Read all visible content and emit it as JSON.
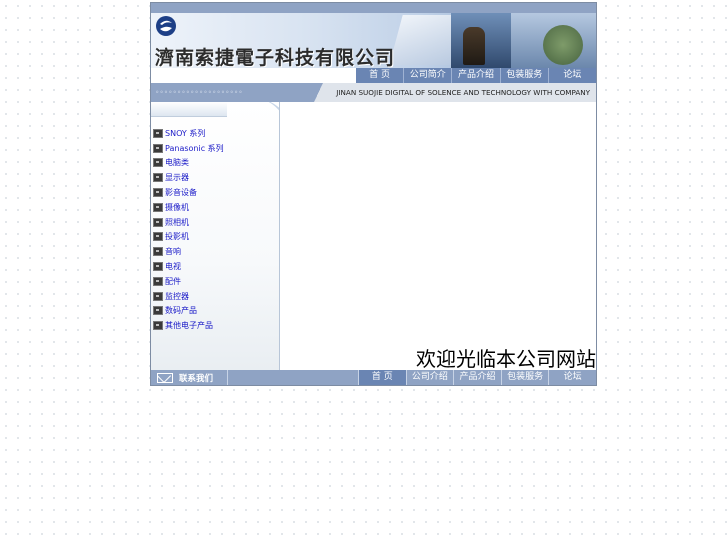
{
  "header": {
    "company_name": "濟南索捷電子科技有限公司",
    "tagline": "JINAN SUOJIE DIGITAL OF SOLENCE AND TECHNOLOGY WITH COMPANY",
    "sub_dots": "∘∘∘∘∘∘∘∘∘∘∘∘∘∘∘∘∘∘∘∘"
  },
  "nav": {
    "items": [
      "首 页",
      "公司简介",
      "产品介绍",
      "包装服务",
      "论坛"
    ]
  },
  "sidebar": {
    "items": [
      "SNOY 系列",
      "Panasonic 系列",
      "电脑类",
      "显示器",
      "影音设备",
      "摄像机",
      "照相机",
      "投影机",
      "音响",
      "电视",
      "配件",
      "监控器",
      "数码产品",
      "其他电子产品"
    ]
  },
  "main": {
    "notice": "欢迎光临本公司网站"
  },
  "footer": {
    "contact_label": "联系我们",
    "items": [
      "首 页",
      "公司介绍",
      "产品介绍",
      "包装服务",
      "论坛"
    ]
  },
  "colors": {
    "nav_bg": "#6a85b3",
    "bar_bg": "#8fa3c4",
    "link": "#1b1bc8"
  }
}
